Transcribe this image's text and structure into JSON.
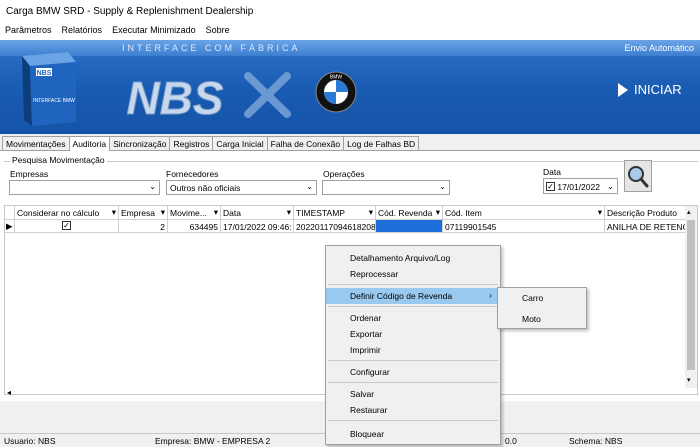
{
  "window": {
    "title": "Carga BMW SRD - Supply & Replenishment Dealership"
  },
  "menu": [
    "Parâmetros",
    "Relatórios",
    "Executar Minimizado",
    "Sobre"
  ],
  "banner": {
    "interface_text": "INTERFACE COM FÁBRICA",
    "envio_text": "Envio Automático",
    "box_text": "NBS",
    "box_sub": "INTERFACE BMW",
    "nbs_logo": "NBS",
    "bmw_text": "BMW",
    "iniciar_label": "INICIAR"
  },
  "tabs": [
    "Movimentações",
    "Auditoria",
    "Sincronização",
    "Registros",
    "Carga Inicial",
    "Falha de Conexão",
    "Log de Falhas BD"
  ],
  "active_tab": "Auditoria",
  "filters": {
    "group_label": "Pesquisa Movimentação",
    "empresas_label": "Empresas",
    "empresas_value": "",
    "fornecedores_label": "Fornecedores",
    "fornecedores_value": "Outros não oficiais",
    "operacoes_label": "Operações",
    "operacoes_value": "",
    "data_label": "Data",
    "data_value": "17/01/2022"
  },
  "grid": {
    "columns": [
      "Considerar no cálculo",
      "Empresa",
      "Movime...",
      "Data",
      "TIMESTAMP",
      "Cód. Revenda",
      "Cód. Item",
      "Descrição Produto"
    ],
    "row": [
      "",
      "2",
      "634495",
      "17/01/2022 09:46:",
      "20220117094618208",
      "",
      "07119901545",
      "ANILHA DE RETENC"
    ]
  },
  "context_menu": {
    "items": [
      "Detalhamento Arquivo/Log",
      "Reprocessar",
      "Definir Código de Revenda",
      "Ordenar",
      "Exportar",
      "Imprimir",
      "Configurar",
      "Salvar",
      "Restaurar",
      "Bloquear"
    ],
    "highlighted": "Definir Código de Revenda",
    "submenu": [
      "Carro",
      "Moto"
    ]
  },
  "status": {
    "usuario": "Usuario: NBS",
    "empresa": "Empresa: BMW - EMPRESA 2",
    "version": "0.0",
    "schema": "Schema: NBS"
  },
  "colors": {
    "banner_blue": "#1a5cb3",
    "selection_blue": "#1e6fd9",
    "menu_highlight": "#99c9ef"
  }
}
